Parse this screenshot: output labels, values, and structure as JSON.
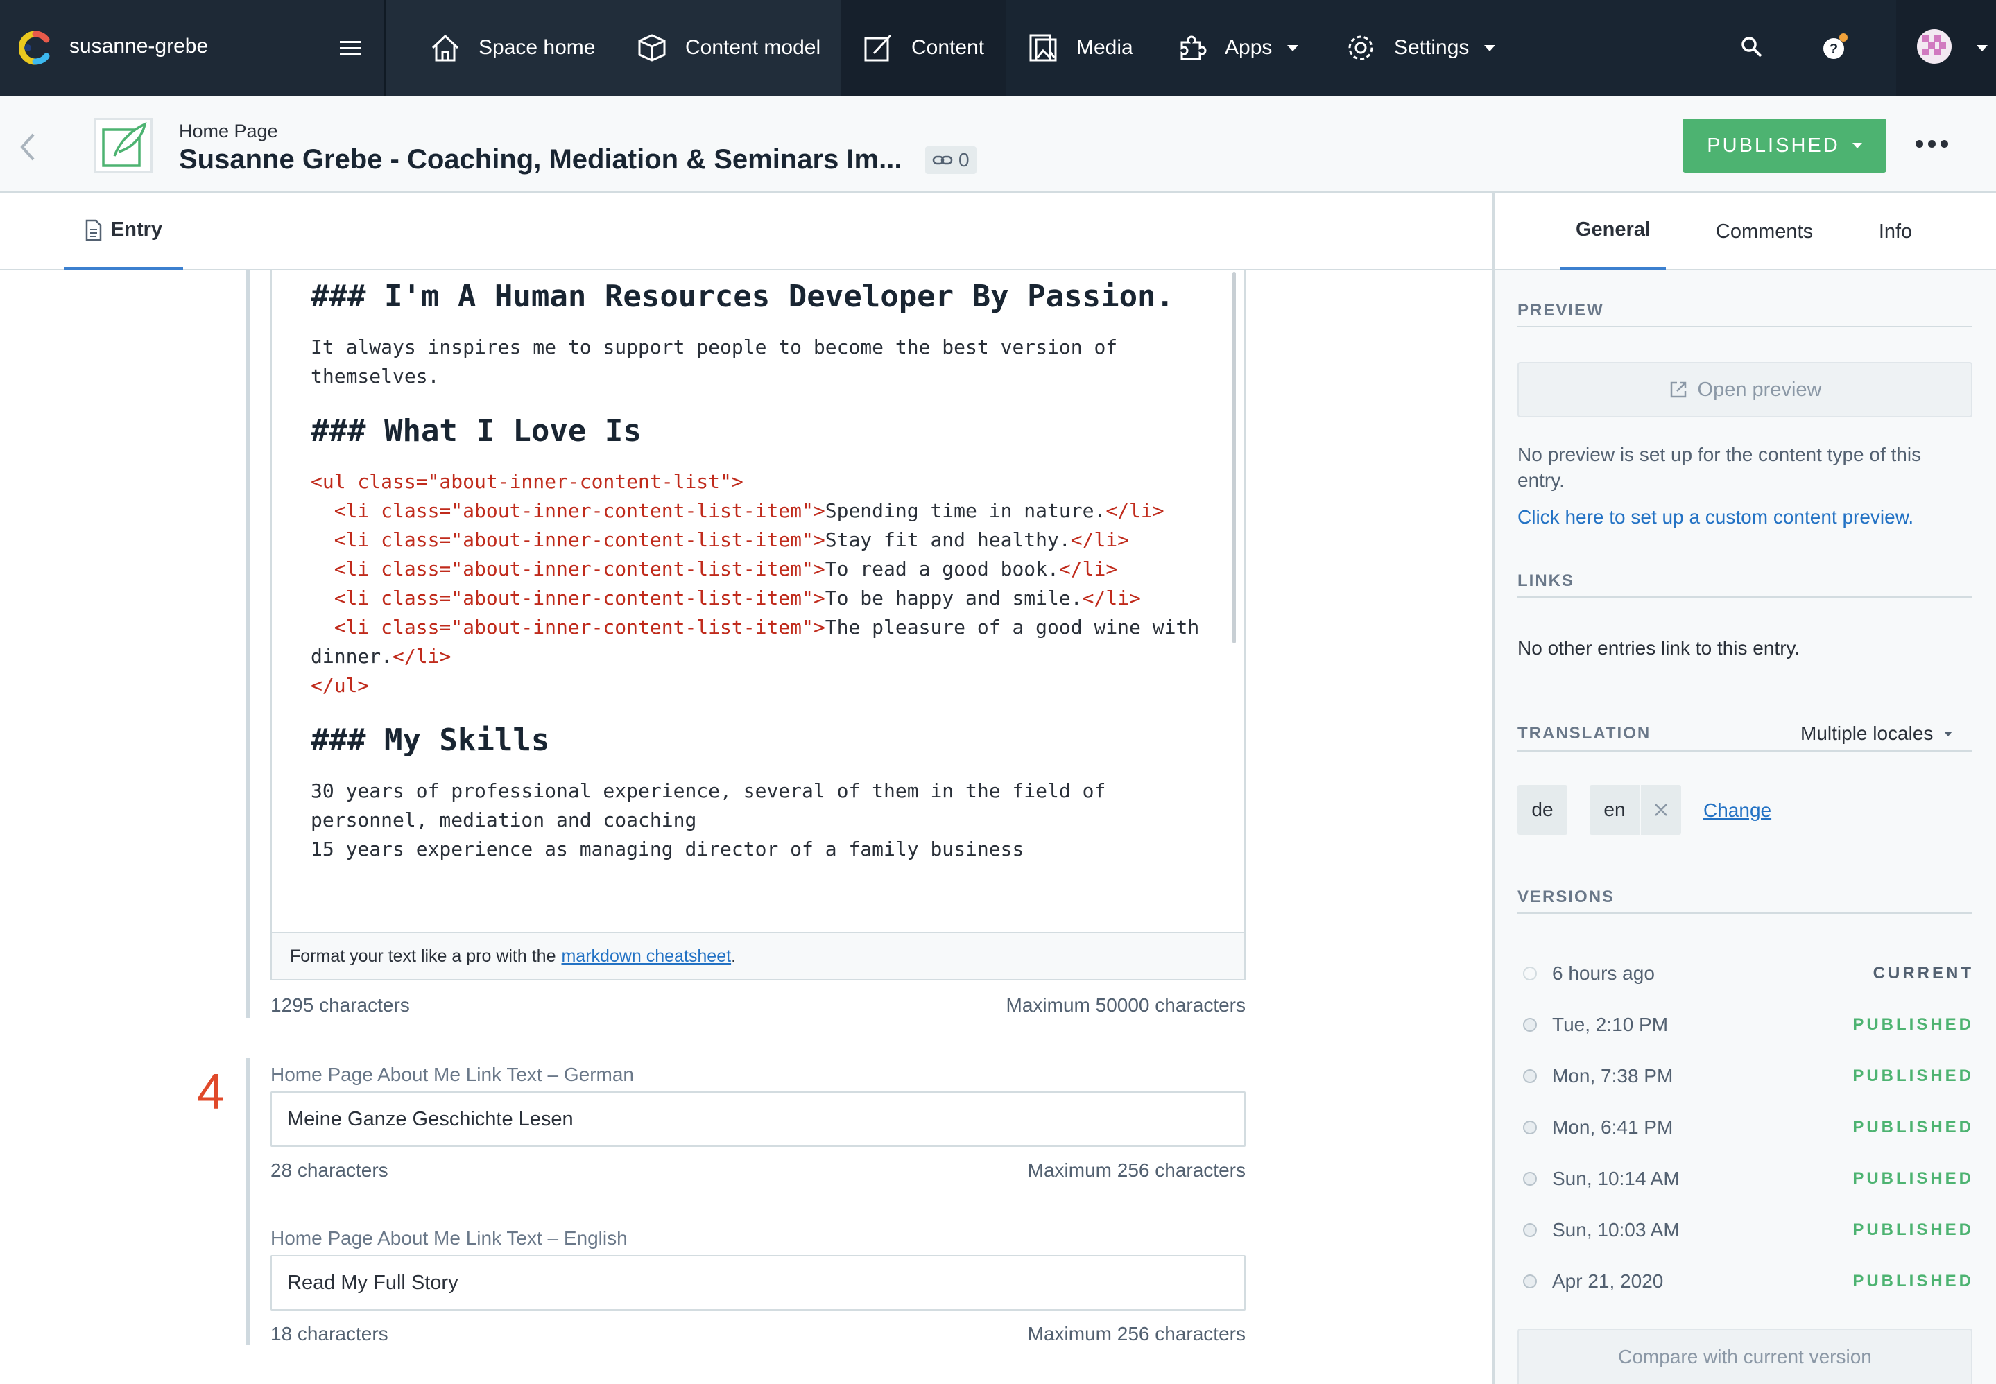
{
  "topbar": {
    "space_name": "susanne-grebe",
    "nav": [
      {
        "label": "Space home",
        "icon": "home-icon"
      },
      {
        "label": "Content model",
        "icon": "content-model-icon"
      },
      {
        "label": "Content",
        "icon": "content-icon",
        "active": true
      },
      {
        "label": "Media",
        "icon": "media-icon"
      },
      {
        "label": "Apps",
        "icon": "apps-icon"
      },
      {
        "label": "Settings",
        "icon": "settings-icon"
      }
    ]
  },
  "entry_header": {
    "content_type": "Home Page",
    "title": "Susanne Grebe - Coaching, Mediation & Seminars Im...",
    "references_count": "0",
    "status_button": "PUBLISHED"
  },
  "tabs": {
    "entry": "Entry",
    "general": "General",
    "comments": "Comments",
    "info": "Info"
  },
  "editor": {
    "lines": [
      "### I'm A Human Resources Developer By Passion.",
      "It always inspires me to support people to become the best version of",
      "themselves.",
      "### What I Love Is",
      "<ul class=\"about-inner-content-list\">",
      "  <li class=\"about-inner-content-list-item\">",
      "Spending time in nature.",
      "Stay fit and healthy.",
      "To read a good book.",
      "To be happy and smile.",
      "The pleasure of a good wine with",
      "dinner.",
      "</li>",
      "</ul>",
      "### My Skills",
      "30 years of professional experience, several of them in the field of",
      "personnel, mediation and coaching",
      "15 years experience as managing director of a family business"
    ],
    "cheat_prefix": "Format your text like a pro with the",
    "cheat_link": "markdown cheatsheet",
    "cheat_suffix": ".",
    "count": "1295 characters",
    "max": "Maximum 50000 characters"
  },
  "field4": {
    "number": "4",
    "german": {
      "label": "Home Page About Me Link Text – German",
      "value": "Meine Ganze Geschichte Lesen",
      "count": "28 characters",
      "max": "Maximum 256 characters"
    },
    "english": {
      "label": "Home Page About Me Link Text – English",
      "value": "Read My Full Story",
      "count": "18 characters",
      "max": "Maximum 256 characters"
    }
  },
  "sidebar": {
    "preview_heading": "PREVIEW",
    "open_preview": "Open preview",
    "preview_note": "No preview is set up for the content type of this entry.",
    "preview_link": "Click here to set up a custom content preview.",
    "links_heading": "LINKS",
    "links_note": "No other entries link to this entry.",
    "translation_heading": "TRANSLATION",
    "translation_select": "Multiple locales",
    "locales": [
      "de",
      "en"
    ],
    "change": "Change",
    "versions_heading": "VERSIONS",
    "versions": [
      {
        "time": "6 hours ago",
        "status": "CURRENT"
      },
      {
        "time": "Tue, 2:10 PM",
        "status": "PUBLISHED"
      },
      {
        "time": "Mon, 7:38 PM",
        "status": "PUBLISHED"
      },
      {
        "time": "Mon, 6:41 PM",
        "status": "PUBLISHED"
      },
      {
        "time": "Sun, 10:14 AM",
        "status": "PUBLISHED"
      },
      {
        "time": "Sun, 10:03 AM",
        "status": "PUBLISHED"
      },
      {
        "time": "Apr 21, 2020",
        "status": "PUBLISHED"
      }
    ],
    "compare": "Compare with current version"
  },
  "colors": {
    "topbar": "#192532",
    "published": "#4db371",
    "link": "#2372c4",
    "tag": "#c02b1c",
    "field_number": "#e0492a"
  }
}
